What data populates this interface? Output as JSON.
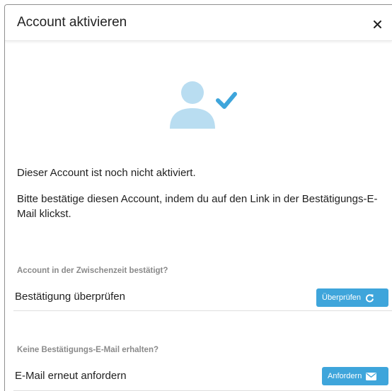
{
  "dialog": {
    "title": "Account aktivieren",
    "close_label": "×"
  },
  "hero": {
    "icon": "user-check-icon",
    "person_color": "#b9ddf1",
    "check_color": "#3ea5db"
  },
  "messages": {
    "not_activated": "Dieser Account ist noch nicht aktiviert.",
    "instructions": "Bitte bestätige diesen Account, indem du auf den Link in der Bestätigungs-E-Mail klickst."
  },
  "verify_section": {
    "label": "Account in der Zwischenzeit bestätigt?",
    "row_text": "Bestätigung überprüfen",
    "button_label": "Überprüfen",
    "button_icon": "refresh-icon"
  },
  "resend_section": {
    "label": "Keine Bestätigungs-E-Mail erhalten?",
    "row_text": "E-Mail erneut anfordern",
    "button_label": "Anfordern",
    "button_icon": "envelope-icon"
  },
  "colors": {
    "accent": "#3ea5db",
    "muted_label": "#8a8a8a"
  }
}
